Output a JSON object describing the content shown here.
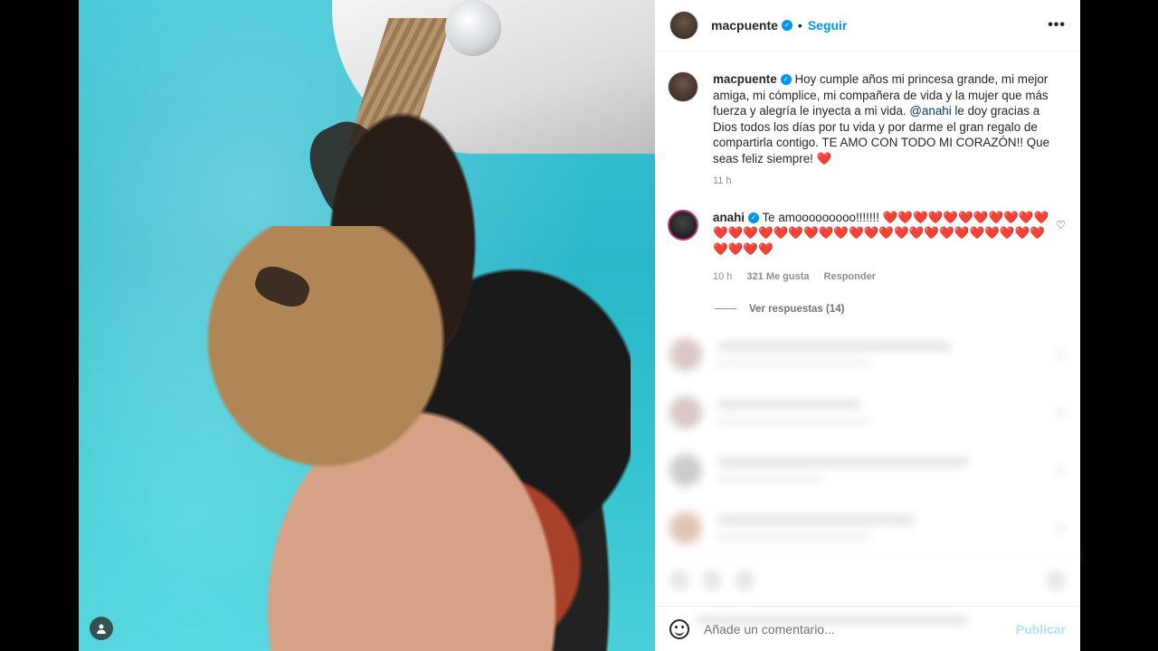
{
  "post": {
    "username": "macpuente",
    "follow_label": "Seguir",
    "dot": "•",
    "more_label": "•••"
  },
  "caption": {
    "username": "macpuente",
    "text_part1": "Hoy cumple años mi princesa grande, mi mejor amiga, mi cómplice, mi compañera de vida y la mujer que más fuerza y alegría le inyecta a mi vida. ",
    "mention": "@anahi",
    "text_part2": " le doy gracias a Dios todos los días por tu vida y por darme el gran regalo de compartirla contigo. TE AMO CON TODO MI CORAZÓN!! Que seas feliz siempre! ",
    "heart": "❤️",
    "time": "11 h"
  },
  "comment": {
    "username": "anahi",
    "text": "Te amooooooooo!!!!!!! ",
    "hearts": "❤️❤️❤️❤️❤️❤️❤️❤️❤️❤️❤️❤️❤️❤️❤️❤️❤️❤️❤️❤️❤️❤️❤️❤️❤️❤️❤️❤️❤️❤️❤️❤️❤️❤️❤️❤️❤️",
    "time": "10 h",
    "likes": "321 Me gusta",
    "reply_label": "Responder",
    "like_icon": "♡",
    "view_replies": "Ver respuestas (14)"
  },
  "add_comment": {
    "placeholder": "Añade un comentario...",
    "publish_label": "Publicar"
  },
  "icons": {
    "verified": "verified-badge-icon",
    "emoji": "emoji-icon",
    "heart": "heart-outline-icon",
    "tag": "user-tag-icon"
  },
  "colors": {
    "accent": "#0095f6",
    "publish_disabled": "#b2dffc",
    "mention": "#00376b",
    "heart": "#ed4956"
  }
}
